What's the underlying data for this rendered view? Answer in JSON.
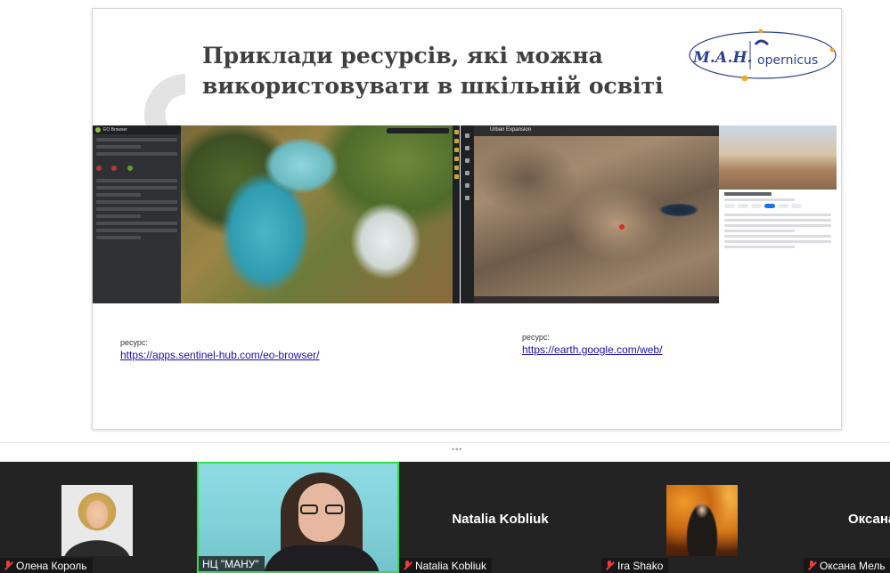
{
  "slide": {
    "title": "Приклади ресурсів, які можна використовувати в шкільній освіті",
    "logo": {
      "left_text": "М.А.Н.",
      "right_text": "opernicus"
    },
    "eo_browser": {
      "app_name": "EO Browser"
    },
    "google_earth": {
      "story_title": "Urban Expansion"
    },
    "resources": [
      {
        "label": "ресурс:",
        "url": "https://apps.sentinel-hub.com/eo-browser/"
      },
      {
        "label": "ресурс:",
        "url": "https://earth.google.com/web/"
      }
    ]
  },
  "gallery": {
    "tiles": [
      {
        "display_name": "",
        "name": "Олена Король",
        "muted": true,
        "mode": "avatar"
      },
      {
        "display_name": "",
        "name": "НЦ \"МАНУ\"",
        "muted": false,
        "mode": "video",
        "active_speaker": true
      },
      {
        "display_name": "Natalia Kobliuk",
        "name": "Natalia Kobliuk",
        "muted": true,
        "mode": "name"
      },
      {
        "display_name": "",
        "name": "Ira Shako",
        "muted": true,
        "mode": "avatar"
      },
      {
        "display_name": "Оксана",
        "name": "Оксана Мель",
        "muted": true,
        "mode": "name"
      }
    ]
  },
  "colors": {
    "active_speaker_border": "#2ee04a",
    "mic_off": "#e83e3e",
    "link": "#1a0dab"
  }
}
